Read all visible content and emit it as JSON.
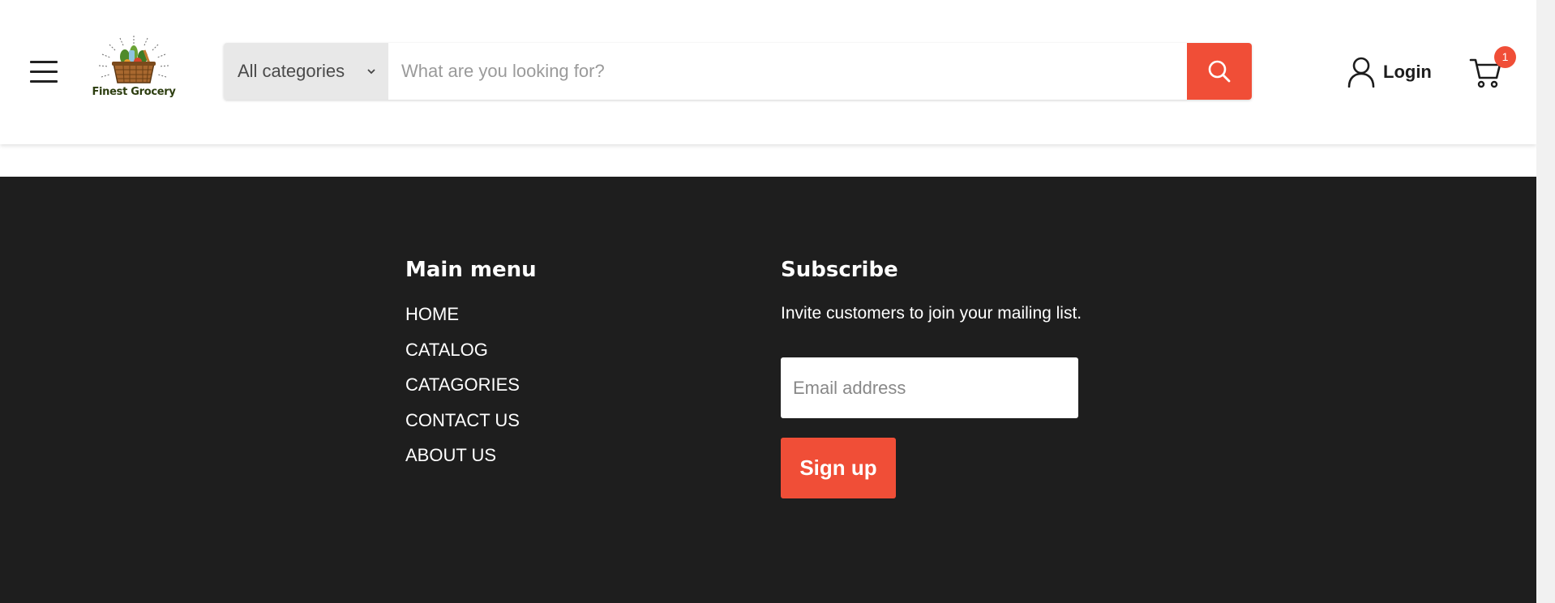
{
  "header": {
    "logo_text": "Finest Grocery",
    "category_select": {
      "selected": "All categories"
    },
    "search": {
      "placeholder": "What are you looking for?",
      "value": ""
    },
    "login_label": "Login",
    "cart_count": "1",
    "icons": {
      "menu": "hamburger-menu-icon",
      "logo": "grocery-basket-logo",
      "chevron": "chevron-down-icon",
      "search": "search-icon",
      "user": "user-icon",
      "cart": "cart-icon"
    }
  },
  "footer": {
    "main_menu": {
      "title": "Main menu",
      "items": [
        "HOME",
        "CATALOG",
        "CATAGORIES",
        "CONTACT US",
        "ABOUT US"
      ]
    },
    "subscribe": {
      "title": "Subscribe",
      "text": "Invite customers to join your mailing list.",
      "email_placeholder": "Email address",
      "button_label": "Sign up"
    }
  },
  "colors": {
    "accent": "#f04e37",
    "footer_bg": "#1e1e1e",
    "header_bg": "#ffffff",
    "category_bg": "#e8e8e8"
  }
}
